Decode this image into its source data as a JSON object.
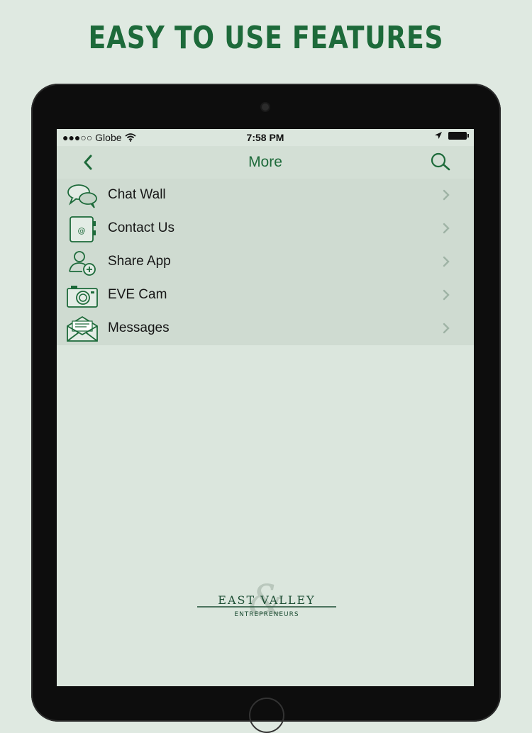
{
  "headline": "EASY TO USE FEATURES",
  "status_bar": {
    "carrier": "●●●○○ Globe",
    "time": "7:58 PM"
  },
  "nav": {
    "title": "More",
    "back_icon": "chevron-left-icon",
    "search_icon": "search-icon"
  },
  "menu": [
    {
      "label": "Chat Wall",
      "icon": "chat-bubbles-icon"
    },
    {
      "label": "Contact Us",
      "icon": "address-book-icon"
    },
    {
      "label": "Share App",
      "icon": "add-user-icon"
    },
    {
      "label": "EVE Cam",
      "icon": "camera-icon"
    },
    {
      "label": "Messages",
      "icon": "envelope-icon"
    }
  ],
  "logo": {
    "name": "EAST VALLEY",
    "tagline": "ENTREPRENEURS"
  },
  "colors": {
    "accent": "#1d6a3a",
    "background": "#dfe9e1"
  }
}
